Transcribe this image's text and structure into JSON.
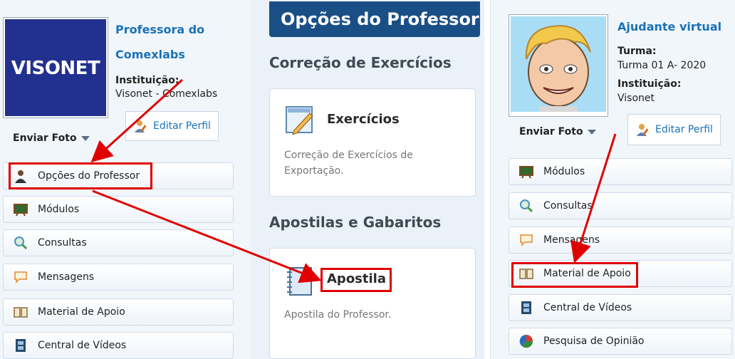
{
  "left": {
    "avatar": {
      "logo_text": "VISONET"
    },
    "name": "Professora do Comexlabs",
    "institution_label": "Instituição:",
    "institution_value": "Visonet - Comexlabs",
    "send_photo": "Enviar Foto",
    "edit_profile": "Editar Perfil",
    "menu": [
      {
        "label": "Opções do Professor",
        "icon": "teacher-icon"
      },
      {
        "label": "Módulos",
        "icon": "chalkboard-icon"
      },
      {
        "label": "Consultas",
        "icon": "magnifier-icon"
      },
      {
        "label": "Mensagens",
        "icon": "speech-bubble-icon"
      },
      {
        "label": "Material de Apoio",
        "icon": "book-icon"
      },
      {
        "label": "Central de Vídeos",
        "icon": "film-icon"
      }
    ]
  },
  "middle": {
    "banner": "Opções do Professor",
    "section1": "Correção de Exercícios",
    "card1": {
      "title": "Exercícios",
      "desc": "Correção de Exercícios de Exportação.",
      "icon": "pencil-paper-icon"
    },
    "section2": "Apostilas e Gabaritos",
    "card2": {
      "title": "Apostila",
      "desc": "Apostila do Professor.",
      "icon": "notebook-icon"
    }
  },
  "right": {
    "name": "Ajudante virtual",
    "class_label": "Turma:",
    "class_value": "Turma 01 A- 2020",
    "institution_label": "Instituição:",
    "institution_value": "Visonet",
    "send_photo": "Enviar Foto",
    "edit_profile": "Editar Perfil",
    "menu": [
      {
        "label": "Módulos",
        "icon": "chalkboard-icon"
      },
      {
        "label": "Consultas",
        "icon": "magnifier-icon"
      },
      {
        "label": "Mensagens",
        "icon": "speech-bubble-icon"
      },
      {
        "label": "Material de Apoio",
        "icon": "book-icon"
      },
      {
        "label": "Central de Vídeos",
        "icon": "film-icon"
      },
      {
        "label": "Pesquisa de Opinião",
        "icon": "pie-chart-icon"
      }
    ]
  },
  "colors": {
    "accent": "#1a72b8",
    "banner": "#1a4f86",
    "highlight": "#e00000"
  }
}
